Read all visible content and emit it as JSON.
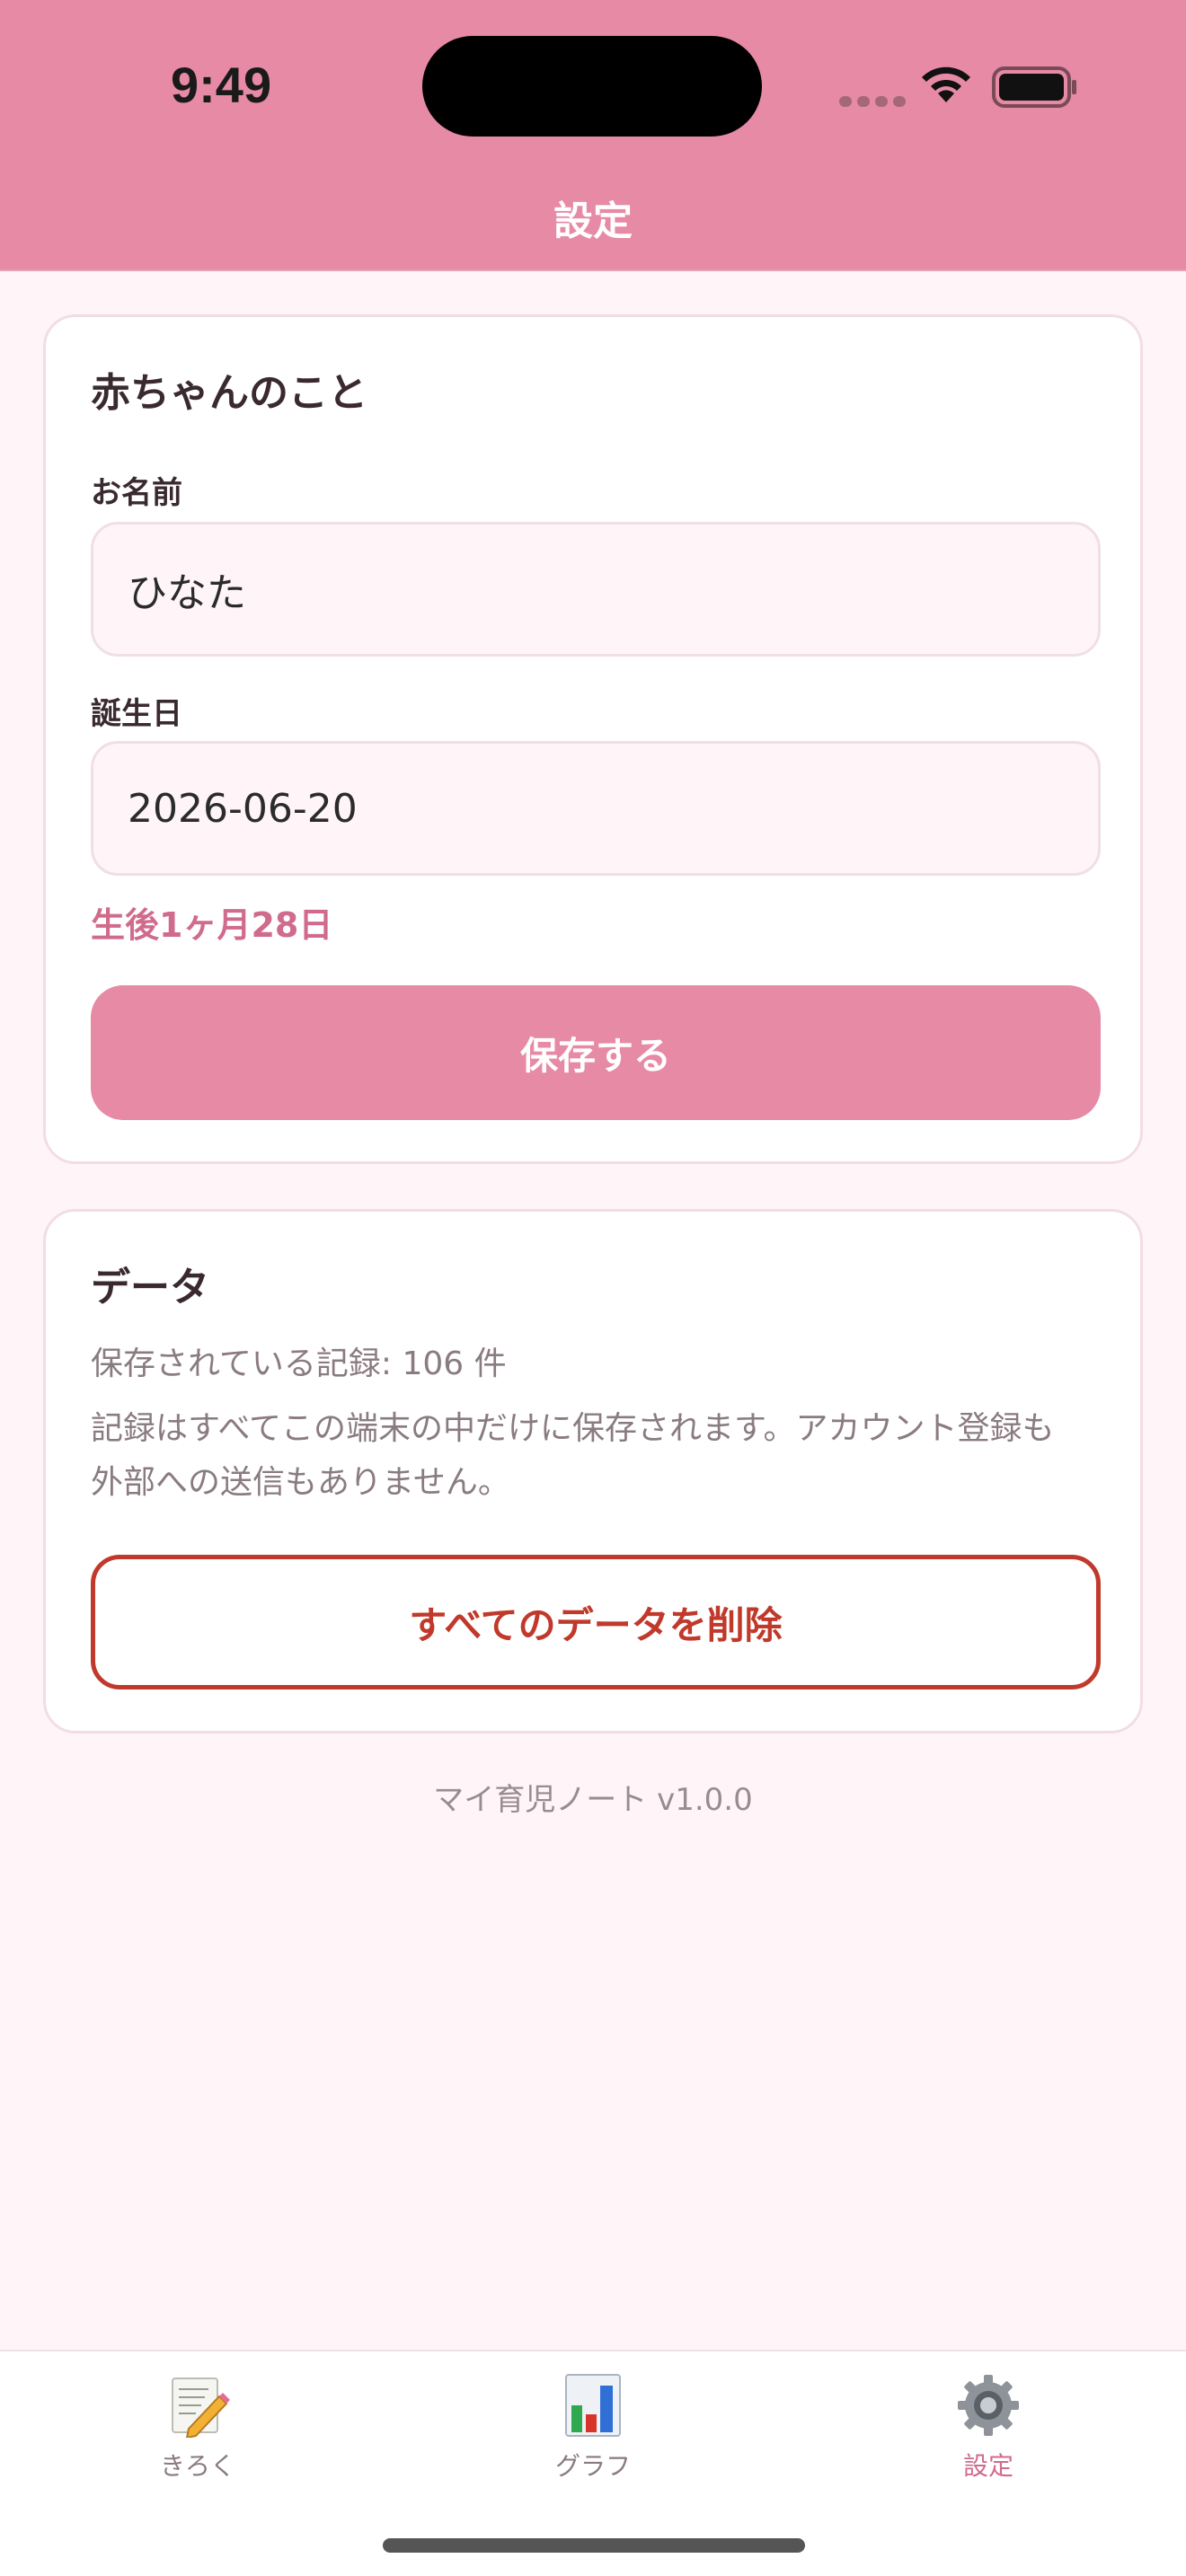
{
  "status": {
    "time": "9:49"
  },
  "header": {
    "title": "設定"
  },
  "baby_card": {
    "title": "赤ちゃんのこと",
    "name_label": "お名前",
    "name_value": "ひなた",
    "birthday_label": "誕生日",
    "birthday_value": "2026-06-20",
    "age_text": "生後1ヶ月28日",
    "save_label": "保存する"
  },
  "data_card": {
    "title": "データ",
    "record_count": "保存されている記録: 106 件",
    "privacy_line1": "記録はすべてこの端末の中だけに保存されます。アカウント登録も",
    "privacy_line2": "外部への送信もありません。",
    "delete_label": "すべてのデータを削除"
  },
  "footer": {
    "version": "マイ育児ノート v1.0.0"
  },
  "tabbar": {
    "tabs": [
      {
        "label": "きろく",
        "icon": "memo-icon",
        "active": false
      },
      {
        "label": "グラフ",
        "icon": "bar-chart-icon",
        "active": false
      },
      {
        "label": "設定",
        "icon": "gear-icon",
        "active": true
      }
    ]
  },
  "colors": {
    "header": "#e68aa6",
    "accent": "#d06b8c",
    "danger": "#c0392b",
    "background": "#fff5f8"
  }
}
